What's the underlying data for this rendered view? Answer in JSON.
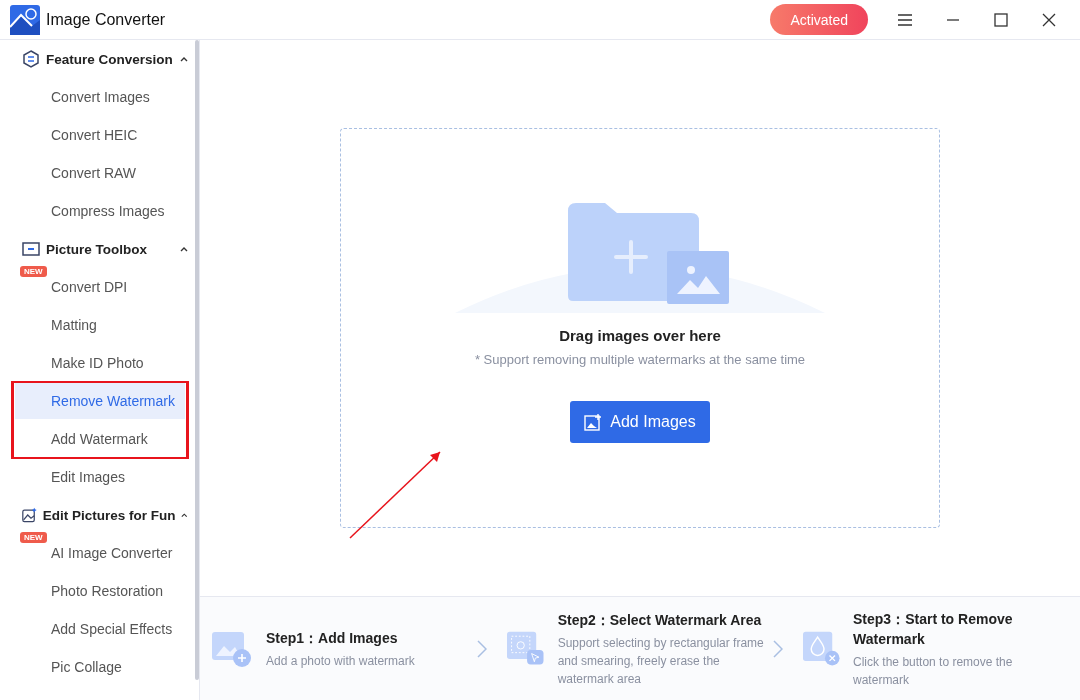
{
  "window": {
    "title": "Image Converter",
    "status_button": "Activated"
  },
  "sidebar": {
    "groups": [
      {
        "title": "Feature Conversion",
        "kind": "convert",
        "expanded": true,
        "items": [
          {
            "label": "Convert Images",
            "selected": false
          },
          {
            "label": "Convert HEIC",
            "selected": false
          },
          {
            "label": "Convert RAW",
            "selected": false
          },
          {
            "label": "Compress Images",
            "selected": false
          }
        ]
      },
      {
        "title": "Picture Toolbox",
        "kind": "toolbox",
        "expanded": true,
        "items": [
          {
            "label": "Convert DPI",
            "selected": false,
            "badge": "NEW"
          },
          {
            "label": "Matting",
            "selected": false
          },
          {
            "label": "Make ID Photo",
            "selected": false
          },
          {
            "label": "Remove Watermark",
            "selected": true
          },
          {
            "label": "Add Watermark",
            "selected": false
          },
          {
            "label": "Edit Images",
            "selected": false
          }
        ]
      },
      {
        "title": "Edit Pictures for Fun",
        "kind": "fun",
        "expanded": true,
        "items": [
          {
            "label": "AI Image Converter",
            "selected": false,
            "badge": "NEW"
          },
          {
            "label": "Photo Restoration",
            "selected": false
          },
          {
            "label": "Add Special Effects",
            "selected": false
          },
          {
            "label": "Pic Collage",
            "selected": false
          }
        ]
      }
    ]
  },
  "dropzone": {
    "title": "Drag images over here",
    "hint": "* Support removing multiple watermarks at the same time",
    "button": "Add Images"
  },
  "steps": [
    {
      "title": "Step1：Add Images",
      "description": "Add a photo with watermark"
    },
    {
      "title": "Step2：Select Watermark Area",
      "description": "Support selecting by rectangular frame and smearing, freely erase the watermark area"
    },
    {
      "title": "Step3：Start to Remove Watermark",
      "description": "Click the button to remove the watermark"
    }
  ]
}
